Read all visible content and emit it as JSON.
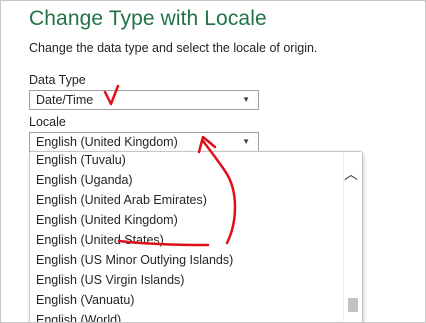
{
  "dialog": {
    "title": "Change Type with Locale",
    "description": "Change the data type and select the locale of origin."
  },
  "data_type": {
    "label": "Data Type",
    "value": "Date/Time"
  },
  "locale": {
    "label": "Locale",
    "value": "English (United Kingdom)"
  },
  "locale_options": [
    "English (Tuvalu)",
    "English (Uganda)",
    "English (United Arab Emirates)",
    "English (United Kingdom)",
    "English (United States)",
    "English (US Minor Outlying Islands)",
    "English (US Virgin Islands)",
    "English (Vanuatu)",
    "English (World)"
  ],
  "icons": {
    "dropdown_arrow": "chevron-down-icon",
    "scroll_up": "chevron-up-icon"
  },
  "colors": {
    "title": "#217346",
    "annotation": "#e0101a"
  }
}
